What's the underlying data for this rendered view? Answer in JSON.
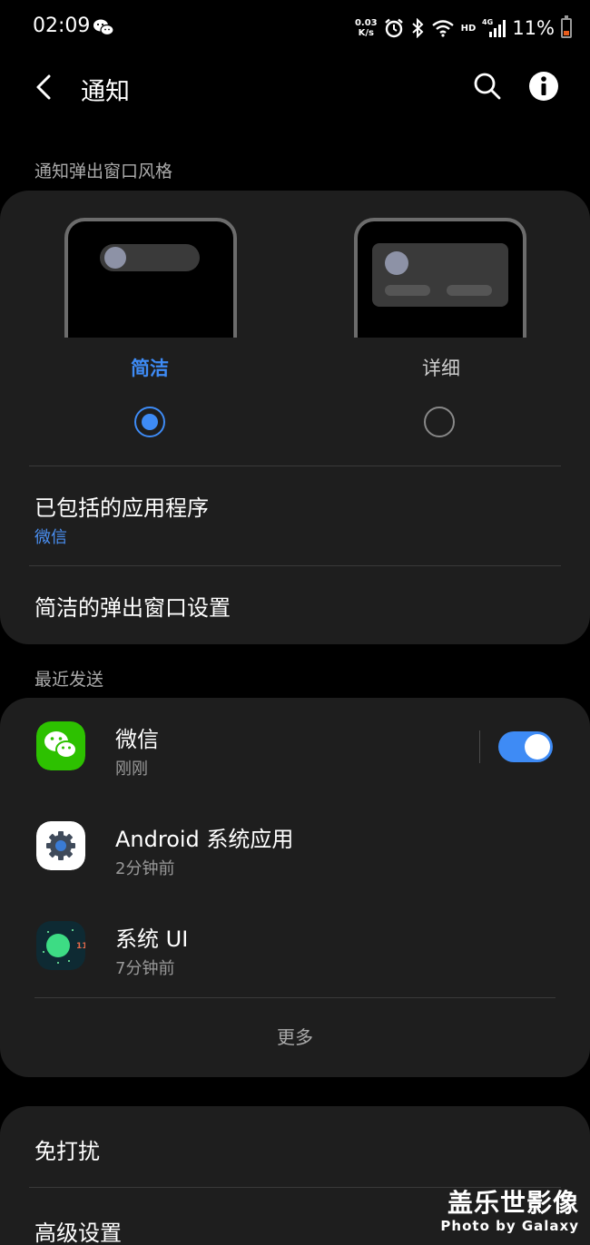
{
  "status_bar": {
    "time": "02:09",
    "net_speed_value": "0.03",
    "net_speed_unit": "K/s",
    "hd": "HD",
    "network": "4G",
    "battery": "11%",
    "icons": [
      "wechat-icon",
      "alarm-icon",
      "bluetooth-icon",
      "wifi-icon",
      "signal-icon",
      "battery-icon"
    ]
  },
  "header": {
    "title": "通知",
    "back_icon": "chevron-left-icon",
    "search_icon": "search-icon",
    "info_icon": "info-icon"
  },
  "popup_style": {
    "section_label": "通知弹出窗口风格",
    "options": [
      {
        "label": "简洁",
        "selected": true
      },
      {
        "label": "详细",
        "selected": false
      }
    ],
    "included_apps_title": "已包括的应用程序",
    "included_apps_value": "微信",
    "brief_settings_title": "简洁的弹出窗口设置"
  },
  "recent": {
    "section_label": "最近发送",
    "apps": [
      {
        "name": "微信",
        "time": "刚刚",
        "icon": "wechat-app-icon",
        "enabled": true
      },
      {
        "name": "Android 系统应用",
        "time": "2分钟前",
        "icon": "android-system-gear-icon"
      },
      {
        "name": "系统 UI",
        "time": "7分钟前",
        "icon": "system-ui-icon",
        "badge": "11"
      }
    ],
    "more_label": "更多"
  },
  "bottom": {
    "dnd_title": "免打扰",
    "advanced_title": "高级设置"
  },
  "watermark": {
    "line1": "盖乐世影像",
    "line2": "Photo by Galaxy"
  },
  "colors": {
    "accent": "#3e8bf5",
    "card": "#1e1e1e",
    "background": "#000000",
    "subtext_blue": "#4a8ff2",
    "wechat_green": "#2dc100"
  }
}
